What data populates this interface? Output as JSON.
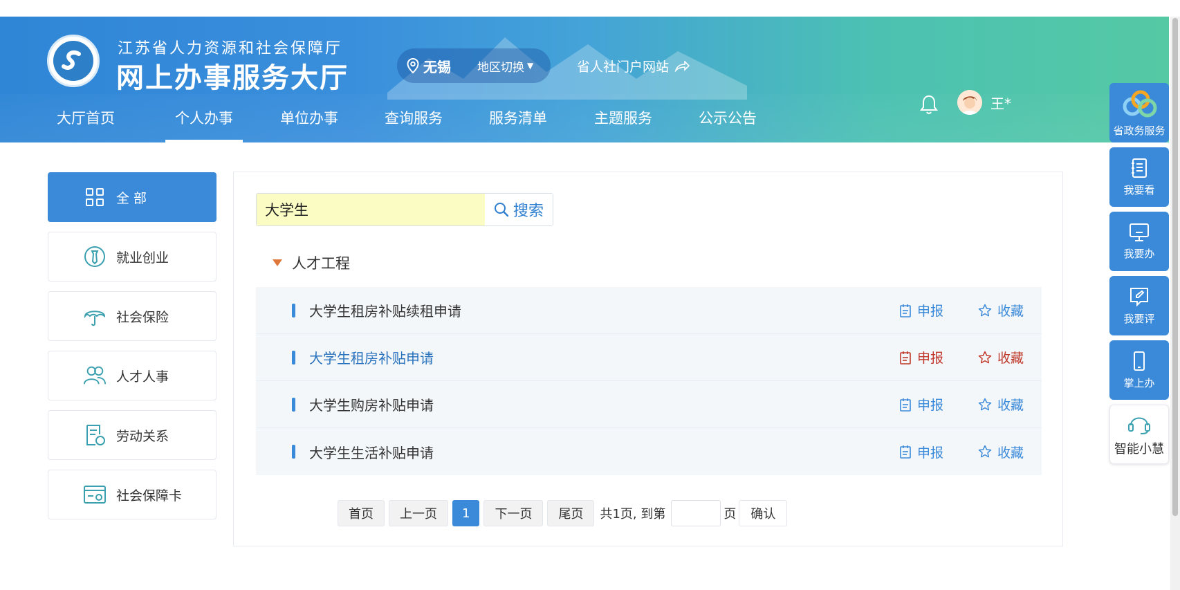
{
  "header": {
    "org_name": "江苏省人力资源和社会保障厅",
    "hall_name": "网上办事服务大厅",
    "region_city": "无锡",
    "region_switch": "地区切换",
    "portal_link": "省人社门户网站",
    "user_name": "王*"
  },
  "nav": {
    "items": [
      "大厅首页",
      "个人办事",
      "单位办事",
      "查询服务",
      "服务清单",
      "主题服务",
      "公示公告"
    ],
    "active": "个人办事"
  },
  "sidebar": {
    "items": [
      {
        "label": "全 部",
        "icon": "grid-icon",
        "active": true
      },
      {
        "label": "就业创业",
        "icon": "employment-icon"
      },
      {
        "label": "社会保险",
        "icon": "umbrella-icon"
      },
      {
        "label": "人才人事",
        "icon": "people-icon"
      },
      {
        "label": "劳动关系",
        "icon": "contract-icon"
      },
      {
        "label": "社会保障卡",
        "icon": "card-icon"
      }
    ]
  },
  "search": {
    "value": "大学生",
    "button_label": "搜索"
  },
  "group": {
    "title": "人才工程"
  },
  "services": [
    {
      "name": "大学生租房补贴续租申请",
      "apply": "申报",
      "fav": "收藏"
    },
    {
      "name": "大学生租房补贴申请",
      "apply": "申报",
      "fav": "收藏",
      "highlighted": true
    },
    {
      "name": "大学生购房补贴申请",
      "apply": "申报",
      "fav": "收藏"
    },
    {
      "name": "大学生生活补贴申请",
      "apply": "申报",
      "fav": "收藏"
    }
  ],
  "pager": {
    "first": "首页",
    "prev": "上一页",
    "current": "1",
    "next": "下一页",
    "last": "尾页",
    "summary": "共1页, 到第",
    "page_suffix": "页",
    "confirm": "确认"
  },
  "float_bar": {
    "items": [
      "省政务服务",
      "我要看",
      "我要办",
      "我要评",
      "掌上办",
      "智能小慧"
    ]
  },
  "colors": {
    "primary": "#3a8ad9",
    "header_left": "#2f86d6",
    "header_right": "#55c9a4",
    "highlight_red": "#c0392b",
    "search_bg": "#fafcc4"
  }
}
